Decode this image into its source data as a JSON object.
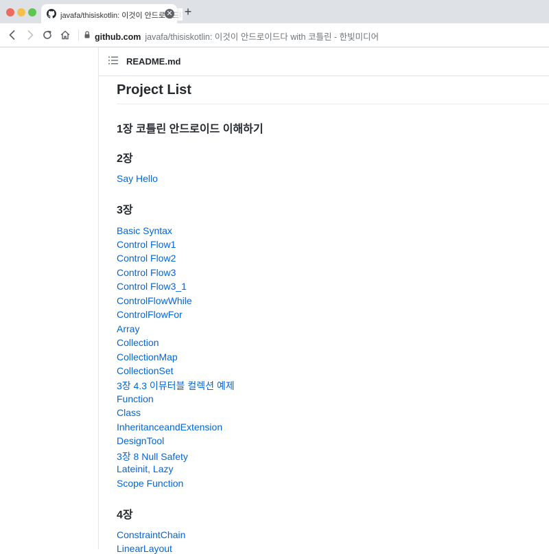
{
  "browser": {
    "tab_title": "javafa/thisiskotlin: 이것이 안드로이드다 with 코틀린 - 한빛미디어",
    "new_tab": "+",
    "close": "✕",
    "url_domain": "github.com",
    "url_path": "javafa/thisiskotlin: 이것이 안드로이드다 with 코틀린 - 한빛미디어"
  },
  "readme": {
    "file_name": "README.md",
    "title": "Project List",
    "sections": [
      {
        "heading": "1장 코틀린 안드로이드 이해하기",
        "links": []
      },
      {
        "heading": "2장",
        "links": [
          "Say Hello"
        ]
      },
      {
        "heading": "3장",
        "links": [
          "Basic Syntax",
          "Control Flow1",
          "Control Flow2",
          "Control Flow3",
          "Control Flow3_1",
          "ControlFlowWhile",
          "ControlFlowFor",
          "Array",
          "Collection",
          "CollectionMap",
          "CollectionSet",
          "3장 4.3 이뮤터블 컬렉션 예제",
          "Function",
          "Class",
          "InheritanceandExtension",
          "DesignTool",
          "3장 8 Null Safety",
          "Lateinit, Lazy",
          "Scope Function"
        ]
      },
      {
        "heading": "4장",
        "links": [
          "ConstraintChain",
          "LinearLayout"
        ]
      }
    ]
  }
}
